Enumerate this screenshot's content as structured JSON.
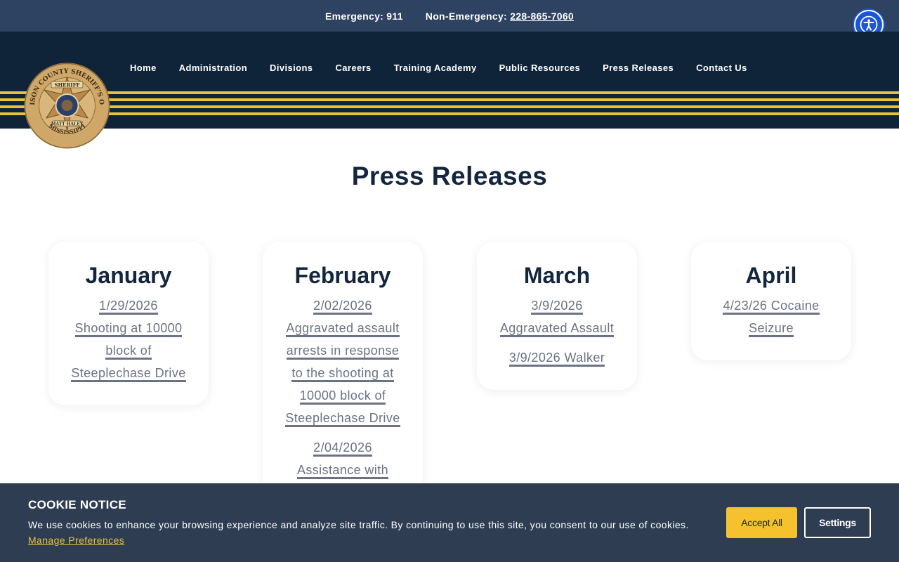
{
  "topbar": {
    "emergency": "Emergency: 911",
    "non_emergency_label": "Non-Emergency:",
    "non_emergency_phone": "228-865-7060"
  },
  "accessibility_icon": "accessibility-icon",
  "badge": {
    "ring_top": "HARRISON COUNTY SHERIFF'S OFFICE",
    "ring_bottom": "MISSISSIPPI",
    "banner": "SHERIFF",
    "name": "MATT HALEY"
  },
  "nav": {
    "items": [
      "Home",
      "Administration",
      "Divisions",
      "Careers",
      "Training Academy",
      "Public Resources",
      "Press Releases",
      "Contact Us"
    ]
  },
  "page": {
    "title": "Press Releases"
  },
  "months": [
    {
      "name": "January",
      "entries": [
        "1/29/2026",
        "Shooting at 10000",
        "block of",
        "Steeplechase Drive"
      ]
    },
    {
      "name": "February",
      "entries": [
        "2/02/2026",
        "Aggravated assault",
        "arrests in response",
        "to the shooting at",
        "10000 block of",
        "Steeplechase Drive",
        "2/04/2026",
        "Assistance with"
      ]
    },
    {
      "name": "March",
      "entries": [
        "3/9/2026",
        "Aggravated Assault",
        "3/9/2026 Walker"
      ]
    },
    {
      "name": "April",
      "entries": [
        "4/23/26 Cocaine",
        "Seizure"
      ]
    }
  ],
  "cookie": {
    "title": "COOKIE NOTICE",
    "text": "We use cookies to enhance your browsing experience and analyze site traffic. By continuing to use this site, you consent to our use of cookies.",
    "manage_link": "Manage Preferences",
    "accept_label": "Accept All",
    "settings_label": "Settings"
  },
  "colors": {
    "topbar": "#2e4261",
    "header": "#0f2339",
    "stripe": "#e8c13d",
    "heading": "#13263d",
    "link": "#6b7284",
    "cookie_bg": "#2e3d52",
    "accept_bg": "#f5c22e",
    "a11y": "#1c55d6"
  }
}
